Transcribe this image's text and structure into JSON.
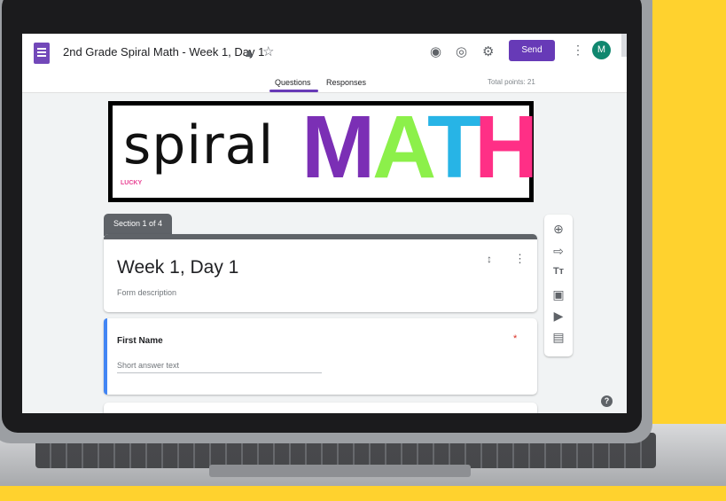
{
  "document": {
    "title": "2nd Grade Spiral Math - Week 1, Day 1"
  },
  "toolbar": {
    "send_label": "Send",
    "avatar_initial": "M",
    "icons": [
      "palette-icon",
      "eye-icon",
      "gear-icon",
      "more-vert-icon"
    ]
  },
  "tabs": {
    "questions": "Questions",
    "responses": "Responses",
    "active": "Questions"
  },
  "total_points": "Total points: 21",
  "banner": {
    "spiral": "spiral",
    "math_letters": [
      {
        "letter": "M",
        "color": "#7b2fb5"
      },
      {
        "letter": "A",
        "color": "#8cf04a"
      },
      {
        "letter": "T",
        "color": "#27b4e6"
      },
      {
        "letter": "H",
        "color": "#ff2f86"
      }
    ],
    "logo_text": "LUCKY"
  },
  "section": {
    "tab_label": "Section 1 of 4",
    "title": "Week 1, Day 1",
    "description_placeholder": "Form description"
  },
  "question": {
    "title": "First Name",
    "required_mark": "*",
    "answer_placeholder": "Short answer text"
  },
  "side_toolbar": {
    "icons": [
      "add-question-icon",
      "import-icon",
      "title-text-icon",
      "image-icon",
      "video-icon",
      "section-icon"
    ]
  },
  "colors": {
    "accent": "#673ab7",
    "avatar": "#10876f",
    "question_bar": "#4285f4",
    "required": "#d93025"
  }
}
